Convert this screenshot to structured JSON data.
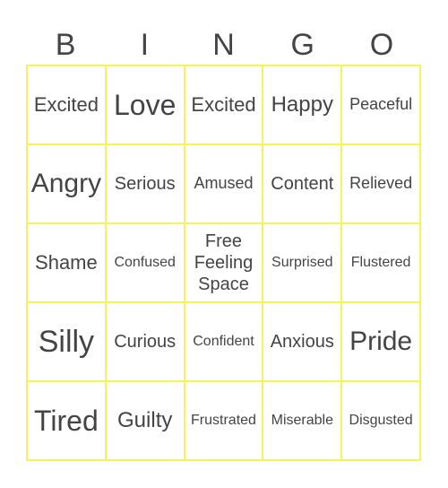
{
  "header": [
    "B",
    "I",
    "N",
    "G",
    "O"
  ],
  "cells": [
    [
      "Excited",
      "Love",
      "Excited",
      "Happy",
      "Peaceful"
    ],
    [
      "Angry",
      "Serious",
      "Amused",
      "Content",
      "Relieved"
    ],
    [
      "Shame",
      "Confused",
      "Free Feeling Space",
      "Surprised",
      "Flustered"
    ],
    [
      "Silly",
      "Curious",
      "Confident",
      "Anxious",
      "Pride"
    ],
    [
      "Tired",
      "Guilty",
      "Frustrated",
      "Miserable",
      "Disgusted"
    ]
  ],
  "colors": {
    "border": "#f3f35a",
    "text": "#444444"
  }
}
